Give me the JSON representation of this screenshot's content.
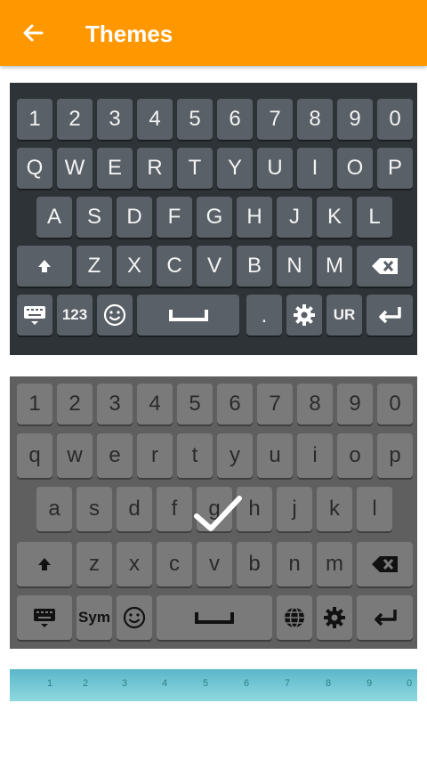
{
  "app_bar": {
    "title": "Themes",
    "back_icon": "arrow-left-icon",
    "color": "#FF9800"
  },
  "theme_dark": {
    "selected": false,
    "row1": [
      "1",
      "2",
      "3",
      "4",
      "5",
      "6",
      "7",
      "8",
      "9",
      "0"
    ],
    "row2": [
      "Q",
      "W",
      "E",
      "R",
      "T",
      "Y",
      "U",
      "I",
      "O",
      "P"
    ],
    "row3": [
      "A",
      "S",
      "D",
      "F",
      "G",
      "H",
      "J",
      "K",
      "L"
    ],
    "row4": [
      "Z",
      "X",
      "C",
      "V",
      "B",
      "N",
      "M"
    ],
    "bottom": {
      "numbers_label": "123",
      "period_label": ".",
      "lang_label": "UR"
    }
  },
  "theme_gray": {
    "selected": true,
    "row1": [
      "1",
      "2",
      "3",
      "4",
      "5",
      "6",
      "7",
      "8",
      "9",
      "0"
    ],
    "row2": [
      "q",
      "w",
      "e",
      "r",
      "t",
      "y",
      "u",
      "i",
      "o",
      "p"
    ],
    "row3": [
      "a",
      "s",
      "d",
      "f",
      "g",
      "h",
      "j",
      "k",
      "l"
    ],
    "row4": [
      "z",
      "x",
      "c",
      "v",
      "b",
      "n",
      "m"
    ],
    "bottom": {
      "symbols_label": "Sym"
    }
  },
  "theme_teal": {
    "selected": false,
    "row1": [
      "1",
      "2",
      "3",
      "4",
      "5",
      "6",
      "7",
      "8",
      "9",
      "0"
    ]
  }
}
